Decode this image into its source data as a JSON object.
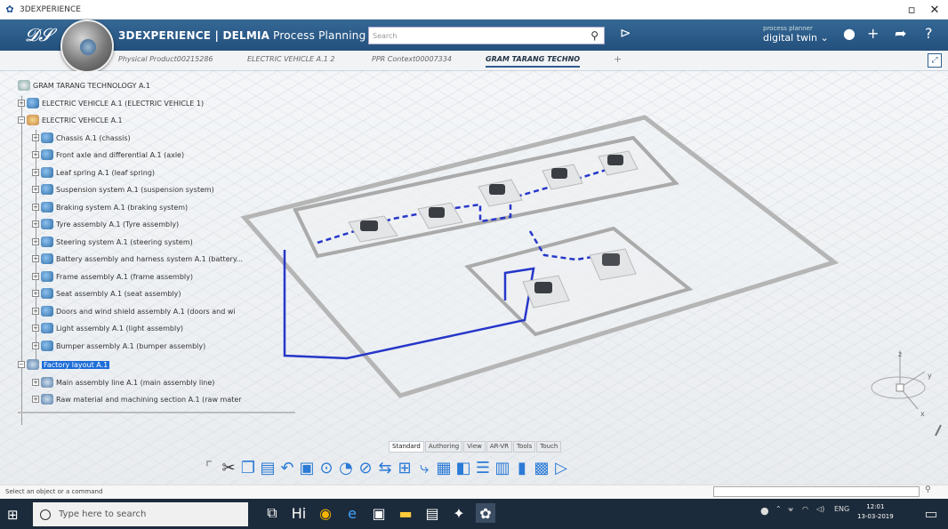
{
  "window": {
    "title": "3DEXPERIENCE"
  },
  "app": {
    "brand_bold": "3DEXPERIENCE | DELMIA",
    "brand_rest": " Process Planning"
  },
  "search": {
    "placeholder": "Search"
  },
  "user": {
    "line1": "process planner",
    "line2": "digital twin ⌄"
  },
  "tabs": [
    "Physical Product00215286",
    "ELECTRIC VEHICLE A.1 2",
    "PPR Context00007334",
    "GRAM TARANG TECHNO",
    "+"
  ],
  "tree": {
    "root": "GRAM TARANG TECHNOLOGY A.1",
    "items": [
      {
        "label": "ELECTRIC VEHICLE A.1 (ELECTRIC VEHICLE 1)",
        "level": 1
      },
      {
        "label": "ELECTRIC VEHICLE A.1",
        "level": 1
      },
      {
        "label": "Chassis A.1 (chassis)",
        "level": 2
      },
      {
        "label": "Front axle and differential A.1 (axle)",
        "level": 2
      },
      {
        "label": "Leaf spring A.1 (leaf spring)",
        "level": 2
      },
      {
        "label": "Suspension system A.1 (suspension system)",
        "level": 2
      },
      {
        "label": "Braking system A.1 (braking system)",
        "level": 2
      },
      {
        "label": "Tyre assembly A.1 (Tyre assembly)",
        "level": 2
      },
      {
        "label": "Steering system A.1 (steering system)",
        "level": 2
      },
      {
        "label": "Battery assembly and harness system A.1 (battery...",
        "level": 2
      },
      {
        "label": "Frame assembly A.1 (frame assembly)",
        "level": 2
      },
      {
        "label": "Seat assembly A.1 (seat assembly)",
        "level": 2
      },
      {
        "label": "Doors and wind shield assembly A.1 (doors and wi",
        "level": 2
      },
      {
        "label": "Light assembly A.1 (light assembly)",
        "level": 2
      },
      {
        "label": "Bumper assembly A.1 (bumper assembly)",
        "level": 2
      },
      {
        "label": "Factory layout A.1",
        "level": 1,
        "selected": true
      },
      {
        "label": "Main assembly line A.1 (main assembly line)",
        "level": 2
      },
      {
        "label": "Raw material and machining section A.1 (raw mater",
        "level": 2
      }
    ]
  },
  "action_tabs": [
    "Standard",
    "Authoring",
    "View",
    "AR-VR",
    "Tools",
    "Touch"
  ],
  "status": {
    "text": "Select an object or a command"
  },
  "taskbar": {
    "search": "Type here to search",
    "time": "12:01",
    "date": "13-03-2019",
    "lang": "ENG"
  },
  "axes": {
    "x": "x",
    "y": "y",
    "z": "z"
  }
}
